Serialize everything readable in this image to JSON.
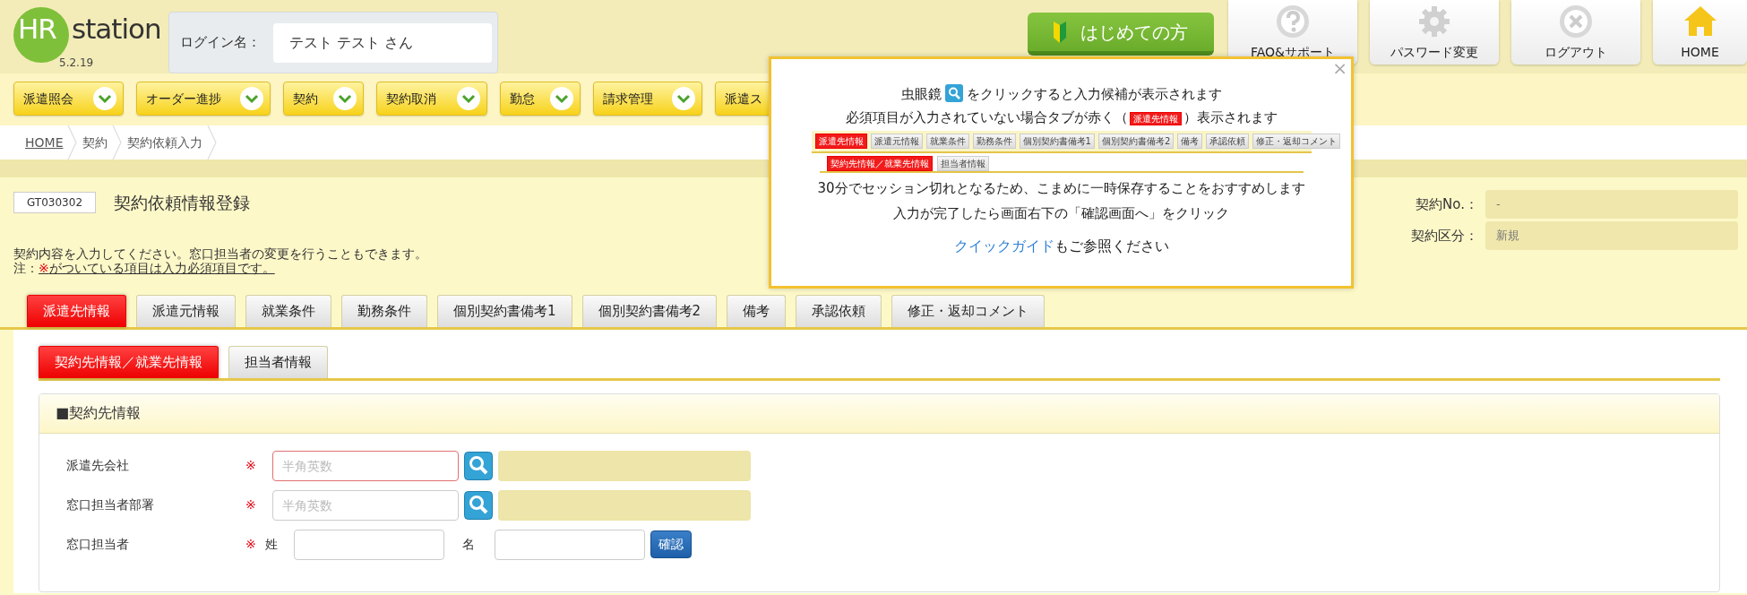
{
  "header": {
    "logo": {
      "mark": "HR",
      "word": "station",
      "version": "5.2.19"
    },
    "login": {
      "label": "ログイン名：",
      "value": "テスト テスト さん"
    },
    "beginner_button": "はじめての方",
    "top_buttons": [
      {
        "label": "FAQ&サポート",
        "kind": "question"
      },
      {
        "label": "パスワード変更",
        "kind": "gear"
      },
      {
        "label": "ログアウト",
        "kind": "close"
      },
      {
        "label": "HOME",
        "kind": "home"
      }
    ]
  },
  "menu": [
    {
      "label": "派遣照会",
      "cut": false
    },
    {
      "label": "オーダー進捗",
      "cut": false
    },
    {
      "label": "契約",
      "cut": false
    },
    {
      "label": "契約取消",
      "cut": false
    },
    {
      "label": "勤怠",
      "cut": false
    },
    {
      "label": "請求管理",
      "cut": false
    },
    {
      "label": "派遣ス",
      "cut": true
    }
  ],
  "breadcrumb": [
    {
      "label": "HOME",
      "link": true
    },
    {
      "label": "契約",
      "link": false
    },
    {
      "label": "契約依頼入力",
      "link": false
    }
  ],
  "page": {
    "screen_id": "GT030302",
    "title": "契約依頼情報登録",
    "intro": "契約内容を入力してください。窓口担当者の変更を行うこともできます。",
    "note": {
      "prefix": "注：",
      "mark": "※",
      "text": "がついている項目は入力必須項目です。"
    }
  },
  "contract_info": [
    {
      "label": "契約No.：",
      "value": "-"
    },
    {
      "label": "契約区分：",
      "value": "新規"
    }
  ],
  "tabs": [
    {
      "label": "派遣先情報",
      "selected": true
    },
    {
      "label": "派遣元情報",
      "selected": false
    },
    {
      "label": "就業条件",
      "selected": false
    },
    {
      "label": "勤務条件",
      "selected": false
    },
    {
      "label": "個別契約書備考1",
      "selected": false
    },
    {
      "label": "個別契約書備考2",
      "selected": false
    },
    {
      "label": "備考",
      "selected": false
    },
    {
      "label": "承認依頼",
      "selected": false
    },
    {
      "label": "修正・返却コメント",
      "selected": false
    }
  ],
  "subtabs": [
    {
      "label": "契約先情報／就業先情報",
      "selected": true
    },
    {
      "label": "担当者情報",
      "selected": false
    }
  ],
  "section": {
    "title": "■契約先情報",
    "rows": [
      {
        "kind": "lookup",
        "label": "派遣先会社",
        "required": true,
        "required_mark": "※",
        "placeholder": "半角英数",
        "error": true
      },
      {
        "kind": "lookup",
        "label": "窓口担当者部署",
        "required": true,
        "required_mark": "※",
        "placeholder": "半角英数",
        "error": false
      },
      {
        "kind": "name",
        "label": "窓口担当者",
        "required": true,
        "required_mark": "※",
        "family_label": "姓",
        "given_label": "名",
        "button": "確認"
      }
    ]
  },
  "popup": {
    "close": "×",
    "line1": {
      "before": "虫眼鏡",
      "after": "をクリックすると入力候補が表示されます"
    },
    "line2": {
      "before": "必須項目が入力されていない場合タブが赤く（",
      "sample": "派遣先情報",
      "after": "）表示されます"
    },
    "mini_tabs": [
      {
        "label": "派遣先情報",
        "selected": true
      },
      {
        "label": "派遣元情報",
        "selected": false
      },
      {
        "label": "就業条件",
        "selected": false
      },
      {
        "label": "勤務条件",
        "selected": false
      },
      {
        "label": "個別契約書備考1",
        "selected": false
      },
      {
        "label": "個別契約書備考2",
        "selected": false
      },
      {
        "label": "備考",
        "selected": false
      },
      {
        "label": "承認依頼",
        "selected": false
      },
      {
        "label": "修正・返却コメント",
        "selected": false
      }
    ],
    "mini_subtabs": [
      {
        "label": "契約先情報／就業先情報",
        "selected": true
      },
      {
        "label": "担当者情報",
        "selected": false
      }
    ],
    "line3": "30分でセッション切れとなるため、こまめに一時保存することをおすすめします",
    "line4": "入力が完了したら画面右下の「確認画面へ」をクリック",
    "guide": {
      "link": "クイックガイド",
      "after": "もご参照ください"
    }
  }
}
